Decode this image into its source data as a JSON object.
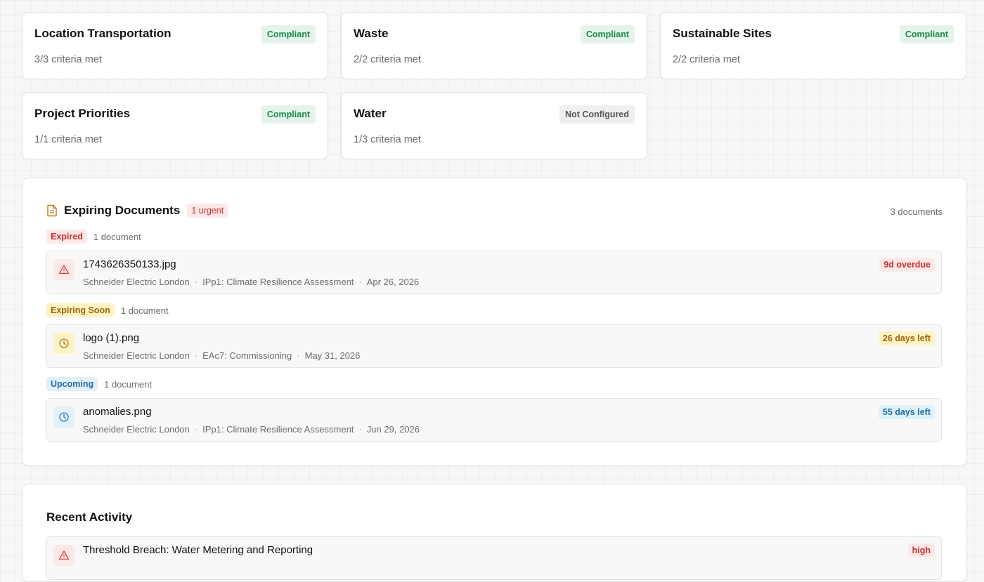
{
  "categories": [
    {
      "title": "Location Transportation",
      "status": "Compliant",
      "criteria": "3/3 criteria met"
    },
    {
      "title": "Waste",
      "status": "Compliant",
      "criteria": "2/2 criteria met"
    },
    {
      "title": "Sustainable Sites",
      "status": "Compliant",
      "criteria": "2/2 criteria met"
    },
    {
      "title": "Project Priorities",
      "status": "Compliant",
      "criteria": "1/1 criteria met"
    },
    {
      "title": "Water",
      "status": "Not Configured",
      "criteria": "1/3 criteria met"
    }
  ],
  "expiring": {
    "title": "Expiring Documents",
    "urgent_badge": "1 urgent",
    "total_count": "3 documents",
    "groups": [
      {
        "label": "Expired",
        "count": "1 document",
        "doc": {
          "name": "1743626350133.jpg",
          "org": "Schneider Electric London",
          "credit": "IPp1: Climate Resilience Assessment",
          "date": "Apr 26, 2026",
          "days": "9d overdue",
          "icon": "warning-triangle-icon"
        }
      },
      {
        "label": "Expiring Soon",
        "count": "1 document",
        "doc": {
          "name": "logo (1).png",
          "org": "Schneider Electric London",
          "credit": "EAc7: Commissioning",
          "date": "May 31, 2026",
          "days": "26 days left",
          "icon": "clock-icon"
        }
      },
      {
        "label": "Upcoming",
        "count": "1 document",
        "doc": {
          "name": "anomalies.png",
          "org": "Schneider Electric London",
          "credit": "IPp1: Climate Resilience Assessment",
          "date": "Jun 29, 2026",
          "days": "55 days left",
          "icon": "clock-icon"
        }
      }
    ],
    "separator": "·"
  },
  "activity": {
    "title": "Recent Activity",
    "items": [
      {
        "name": "Threshold Breach: Water Metering and Reporting",
        "severity": "high",
        "icon": "warning-triangle-icon"
      }
    ]
  },
  "colors": {
    "compliant": "#1f8a4c",
    "not_configured": "#555555",
    "expired": "#c53030",
    "expiring_soon": "#a16207",
    "upcoming": "#1d6fa5"
  }
}
